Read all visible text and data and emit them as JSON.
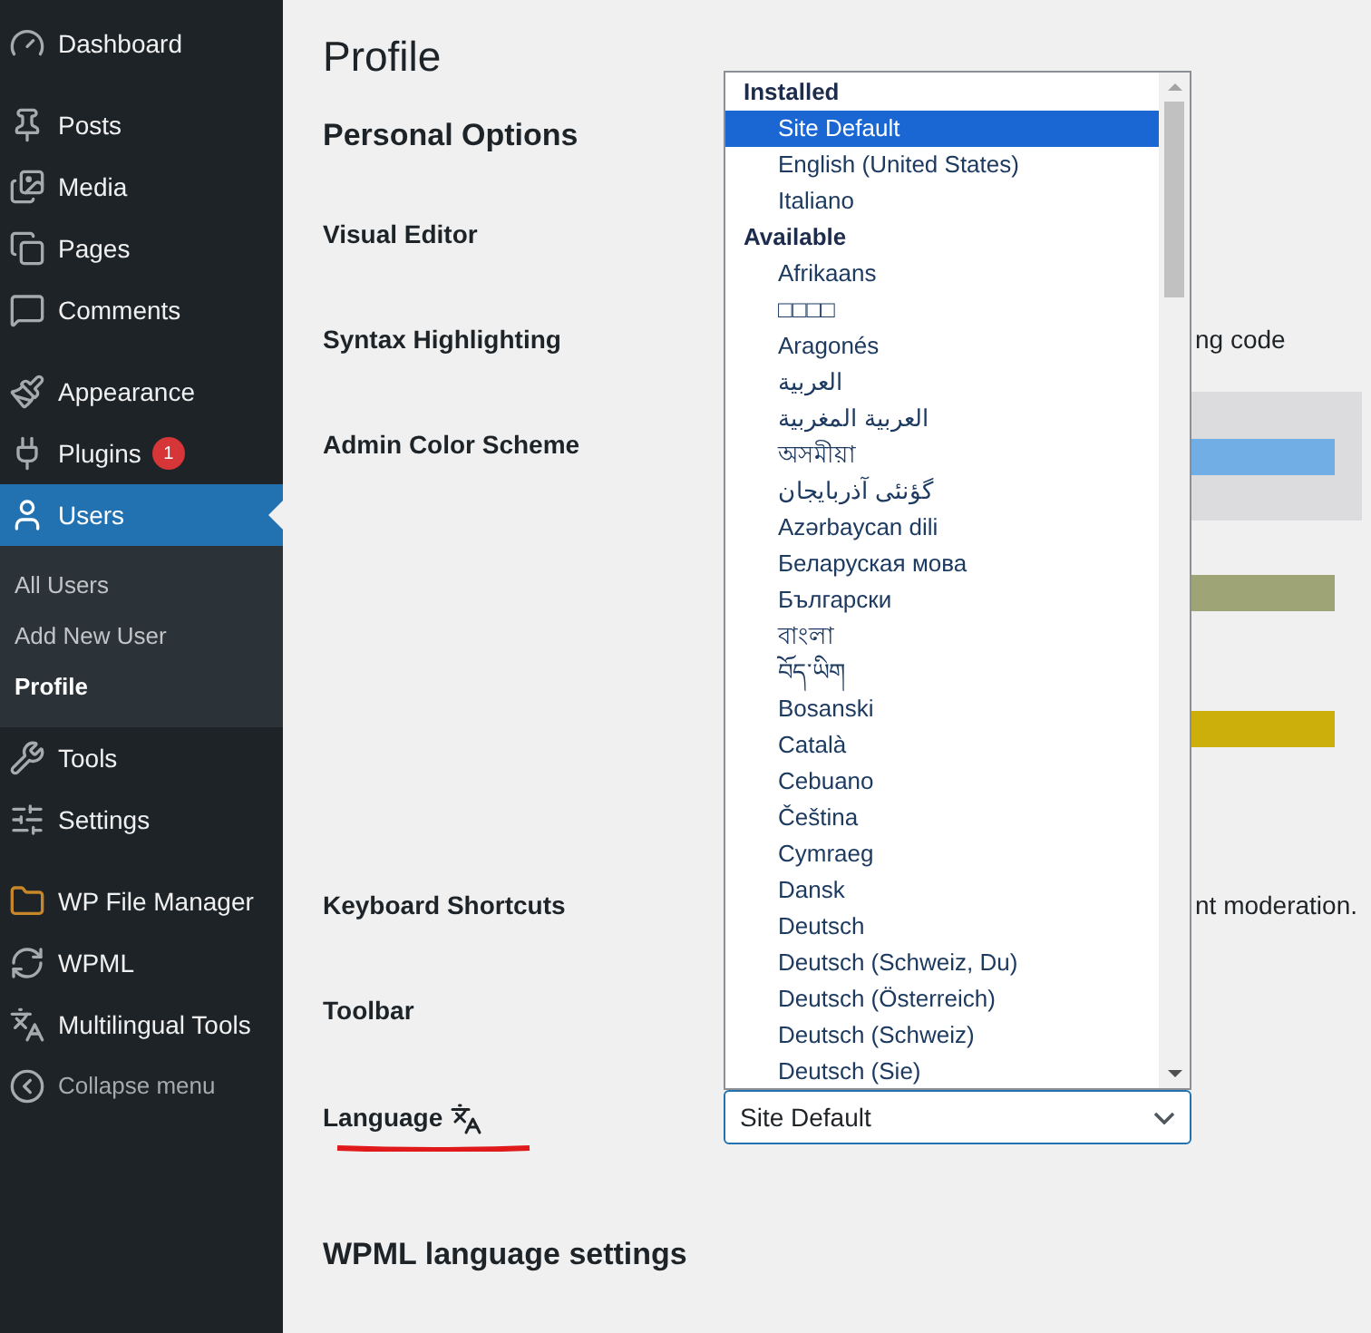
{
  "sidebar": {
    "items": [
      {
        "label": "Dashboard",
        "selected": false
      },
      {
        "label": "Posts",
        "selected": false
      },
      {
        "label": "Media",
        "selected": false
      },
      {
        "label": "Pages",
        "selected": false
      },
      {
        "label": "Comments",
        "selected": false
      },
      {
        "label": "Appearance",
        "selected": false
      },
      {
        "label": "Plugins",
        "selected": false,
        "badge": "1"
      },
      {
        "label": "Users",
        "selected": true,
        "children": [
          {
            "label": "All Users",
            "selected": false
          },
          {
            "label": "Add New User",
            "selected": false
          },
          {
            "label": "Profile",
            "selected": true
          }
        ]
      },
      {
        "label": "Tools",
        "selected": false
      },
      {
        "label": "Settings",
        "selected": false
      },
      {
        "label": "WP File Manager",
        "selected": false
      },
      {
        "label": "WPML",
        "selected": false
      },
      {
        "label": "Multilingual Tools",
        "selected": false
      }
    ],
    "collapse": "Collapse menu"
  },
  "page_title": "Profile",
  "section_title": "Personal Options",
  "fields": [
    {
      "label": "Visual Editor"
    },
    {
      "label": "Syntax Highlighting",
      "text": "ng code"
    },
    {
      "label": "Admin Color Scheme"
    },
    {
      "label": "Keyboard Shortcuts",
      "text": "nt moderation."
    },
    {
      "label": "Toolbar"
    }
  ],
  "color_schemes": [
    {
      "color": "#72aee6",
      "selected": true
    },
    {
      "color": "#9ea476",
      "selected": false
    },
    {
      "color": "#ccaf0b",
      "selected": false
    }
  ],
  "language": {
    "label": "Language",
    "value": "Site Default",
    "expanded": true,
    "groups": [
      {
        "label": "Installed",
        "options": [
          {
            "label": "Site Default",
            "selected": true
          },
          {
            "label": "English (United States)",
            "selected": false
          },
          {
            "label": "Italiano",
            "selected": false
          }
        ]
      },
      {
        "label": "Available",
        "options": [
          {
            "label": "Afrikaans",
            "selected": false
          },
          {
            "label": "□□□□",
            "selected": false
          },
          {
            "label": "Aragonés",
            "selected": false
          },
          {
            "label": "العربية",
            "selected": false
          },
          {
            "label": "العربية المغربية",
            "selected": false
          },
          {
            "label": "অসমীয়া",
            "selected": false
          },
          {
            "label": "گؤنئی آذربایجان",
            "selected": false
          },
          {
            "label": "Azərbaycan dili",
            "selected": false
          },
          {
            "label": "Беларуская мова",
            "selected": false
          },
          {
            "label": "Български",
            "selected": false
          },
          {
            "label": "বাংলা",
            "selected": false
          },
          {
            "label": "བོད་ཡིག",
            "selected": false
          },
          {
            "label": "Bosanski",
            "selected": false
          },
          {
            "label": "Català",
            "selected": false
          },
          {
            "label": "Cebuano",
            "selected": false
          },
          {
            "label": "Čeština",
            "selected": false
          },
          {
            "label": "Cymraeg",
            "selected": false
          },
          {
            "label": "Dansk",
            "selected": false
          },
          {
            "label": "Deutsch",
            "selected": false
          },
          {
            "label": "Deutsch (Schweiz, Du)",
            "selected": false
          },
          {
            "label": "Deutsch (Österreich)",
            "selected": false
          },
          {
            "label": "Deutsch (Schweiz)",
            "selected": false
          },
          {
            "label": "Deutsch (Sie)",
            "selected": false
          }
        ]
      }
    ]
  },
  "wpml_title": "WPML language settings"
}
